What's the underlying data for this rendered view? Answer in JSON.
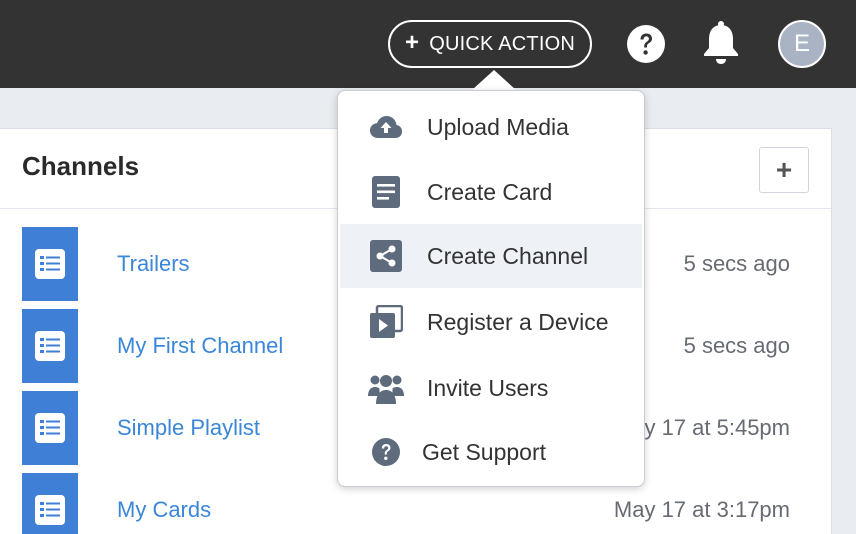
{
  "topbar": {
    "quick_action_label": "QUICK ACTION",
    "quick_action_icon": "plus-icon",
    "avatar_initial": "E"
  },
  "channels": {
    "title": "Channels",
    "add_label": "+",
    "rows": [
      {
        "name": "Trailers",
        "time": "5 secs ago"
      },
      {
        "name": "My First Channel",
        "time": "5 secs ago"
      },
      {
        "name": "Simple Playlist",
        "time": "May 17 at 5:45pm"
      },
      {
        "name": "My Cards",
        "time": "May 17 at 3:17pm"
      }
    ]
  },
  "menu": {
    "items": [
      {
        "label": "Upload Media",
        "icon": "cloud-upload-icon"
      },
      {
        "label": "Create Card",
        "icon": "card-icon"
      },
      {
        "label": "Create Channel",
        "icon": "share-icon",
        "active": true
      },
      {
        "label": "Register a Device",
        "icon": "device-icon"
      },
      {
        "label": "Invite Users",
        "icon": "users-icon"
      },
      {
        "label": "Get Support",
        "icon": "help-icon"
      }
    ]
  },
  "colors": {
    "topbar": "#333333",
    "link": "#3a87d8",
    "thumb": "#3f7fd6",
    "menu_icon": "#5e6b7c",
    "active_row": "#eef2f7"
  }
}
